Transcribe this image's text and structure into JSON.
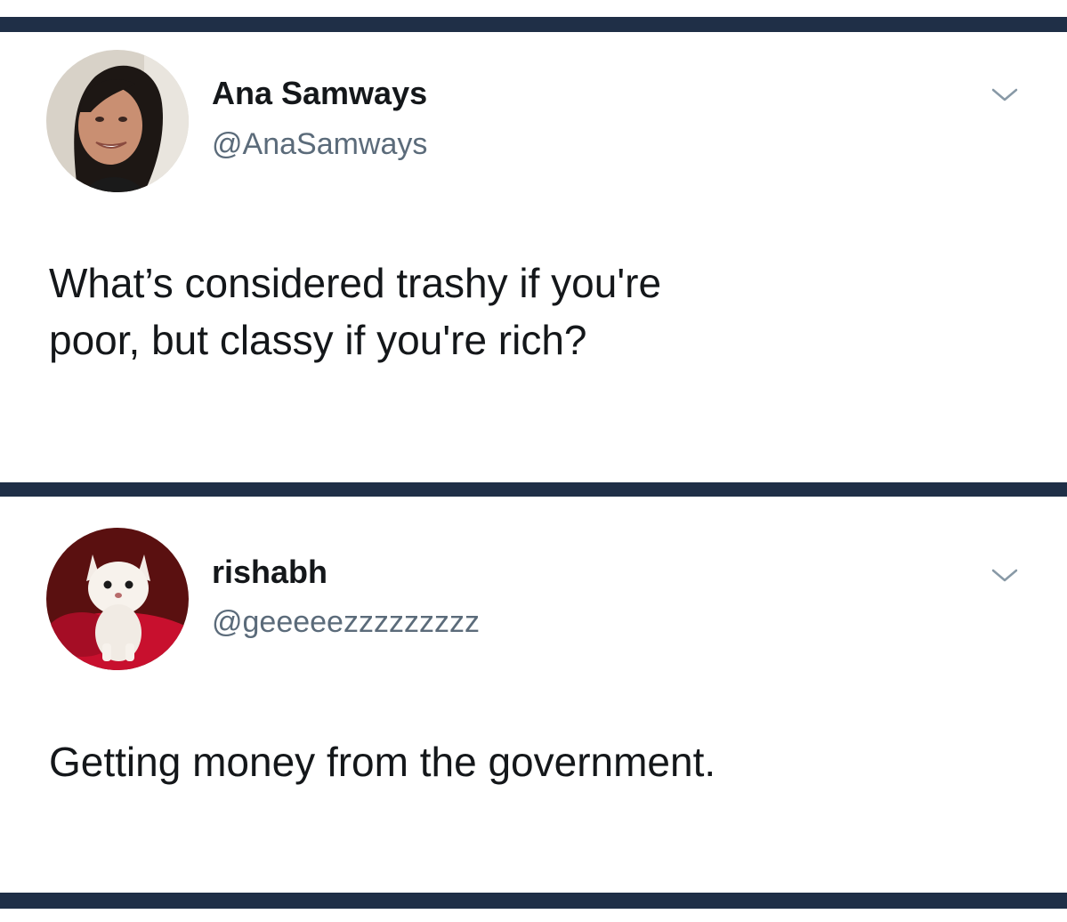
{
  "tweets": [
    {
      "display_name": "Ana Samways",
      "handle": "@AnaSamways",
      "text": "What’s considered trashy if you're\npoor, but classy if you're rich?",
      "avatar_icon": "person-photo",
      "menu_icon": "chevron-down-icon"
    },
    {
      "display_name": "rishabh",
      "handle": "@geeeeezzzzzzzzz",
      "text": "Getting money from the government.",
      "avatar_icon": "kitten-photo",
      "menu_icon": "chevron-down-icon"
    }
  ],
  "colors": {
    "divider": "#1f2f47",
    "text": "#14171a",
    "handle": "#5b6b7a",
    "background": "#ffffff"
  }
}
